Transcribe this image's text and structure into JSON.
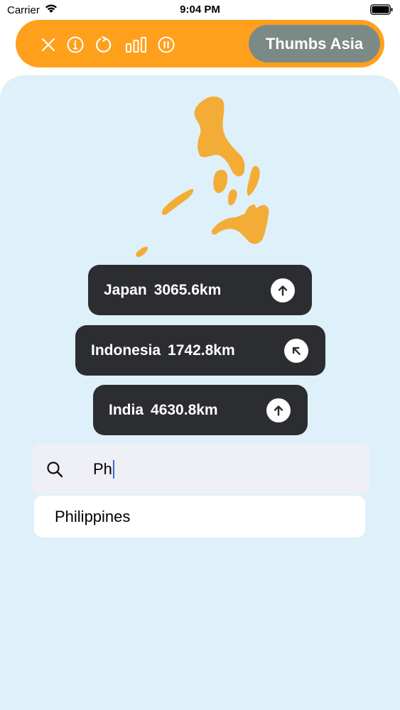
{
  "status_bar": {
    "carrier": "Carrier",
    "time": "9:04 PM"
  },
  "toolbar": {
    "background": "#FFA01C",
    "icons": [
      "close-icon",
      "info-icon",
      "refresh-icon",
      "stats-icon",
      "pause-icon"
    ],
    "title": "Thumbs Asia",
    "title_pill_color": "#7C8A87"
  },
  "map": {
    "country_shape": "philippines-silhouette",
    "color": "#F3AC35"
  },
  "guesses": [
    {
      "country": "Japan",
      "distance": "3065.6km",
      "direction": "north"
    },
    {
      "country": "Indonesia",
      "distance": "1742.8km",
      "direction": "north-west"
    },
    {
      "country": "India",
      "distance": "4630.8km",
      "direction": "north"
    }
  ],
  "search": {
    "value": "Ph",
    "icon": "search-icon"
  },
  "suggestions": [
    "Philippines"
  ],
  "colors": {
    "panel_background": "#DEF0F9",
    "guess_background": "#2C2D30"
  }
}
